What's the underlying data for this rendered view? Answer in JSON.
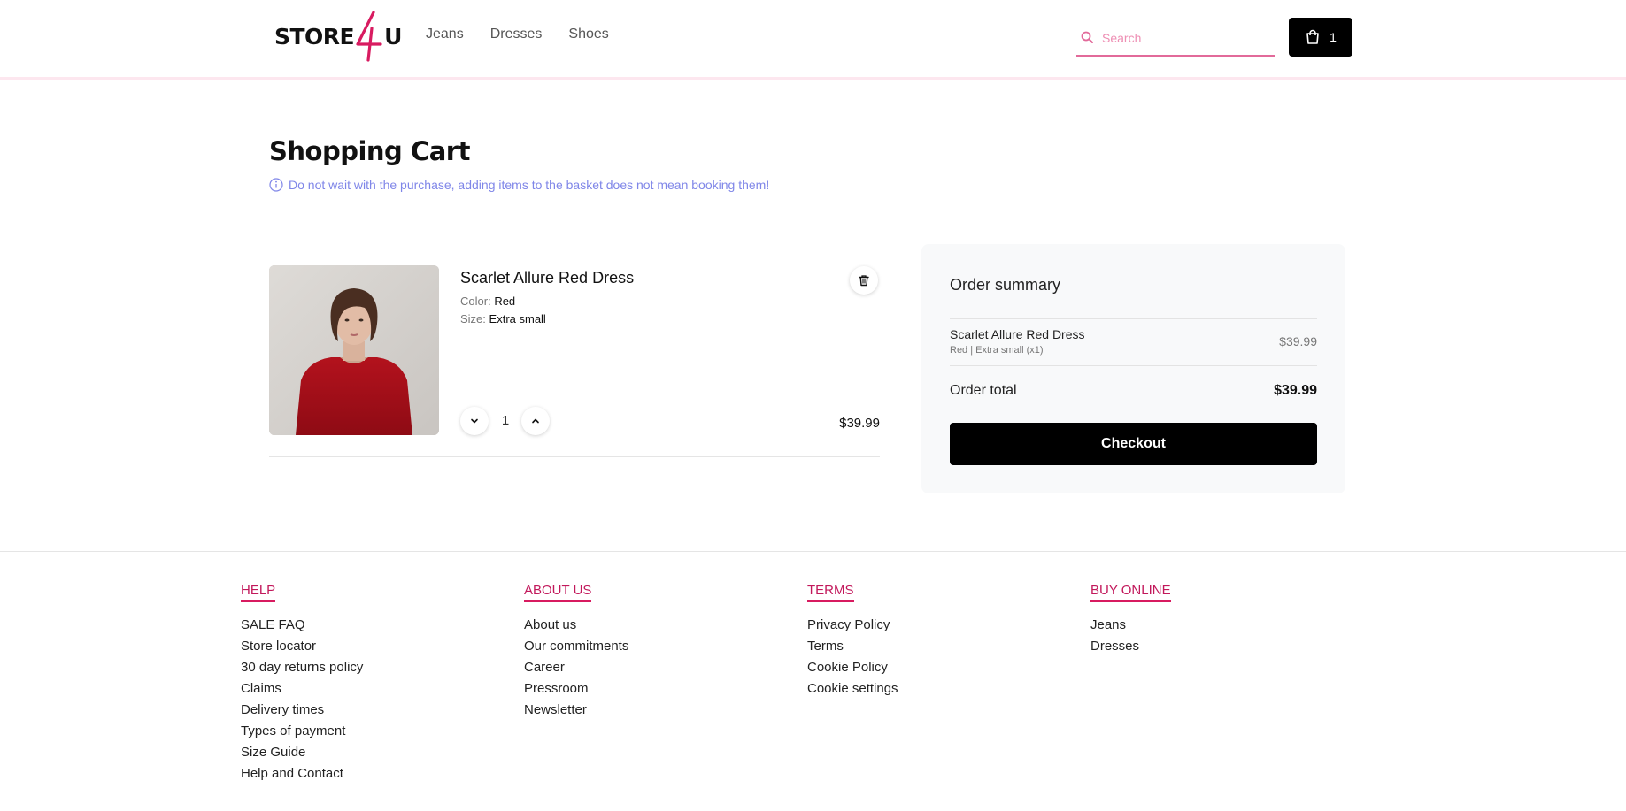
{
  "header": {
    "logo_text": "STORE",
    "logo_accent": "4",
    "logo_suffix": "U",
    "nav": [
      "Jeans",
      "Dresses",
      "Shoes"
    ],
    "search_placeholder": "Search",
    "cart_count": "1"
  },
  "page": {
    "title": "Shopping Cart",
    "notice": "Do not wait with the purchase, adding items to the basket does not mean booking them!"
  },
  "cart_item": {
    "name": "Scarlet Allure Red Dress",
    "color_label": "Color:",
    "color_value": "Red",
    "size_label": "Size:",
    "size_value": "Extra small",
    "quantity": "1",
    "price": "$39.99"
  },
  "summary": {
    "title": "Order summary",
    "item_name": "Scarlet Allure Red Dress",
    "item_sub": "Red | Extra small (x1)",
    "item_price": "$39.99",
    "total_label": "Order total",
    "total_value": "$39.99",
    "checkout_label": "Checkout"
  },
  "footer": {
    "columns": [
      {
        "heading": "HELP",
        "links": [
          "SALE FAQ",
          "Store locator",
          "30 day returns policy",
          "Claims",
          "Delivery times",
          "Types of payment",
          "Size Guide",
          "Help and Contact"
        ]
      },
      {
        "heading": "ABOUT US",
        "links": [
          "About us",
          "Our commitments",
          "Career",
          "Pressroom",
          "Newsletter"
        ]
      },
      {
        "heading": "TERMS",
        "links": [
          "Privacy Policy",
          "Terms",
          "Cookie Policy",
          "Cookie settings"
        ]
      },
      {
        "heading": "BUY ONLINE",
        "links": [
          "Jeans",
          "Dresses"
        ]
      }
    ]
  },
  "colors": {
    "accent": "#d81b60",
    "notice": "#7f86e8",
    "dark": "#000000"
  },
  "icons": {
    "search": "search-icon",
    "cart": "shopping-bag-icon",
    "info": "info-icon",
    "delete": "trash-icon",
    "decrease": "chevron-down-icon",
    "increase": "chevron-up-icon"
  }
}
